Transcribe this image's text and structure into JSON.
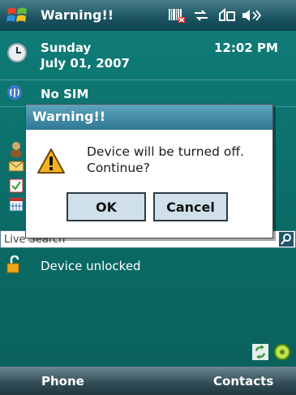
{
  "titlebar": {
    "title": "Warning!!",
    "icons": [
      "windows-start-icon",
      "barcode-icon",
      "sync-arrows-icon",
      "connectivity-icon",
      "volume-icon"
    ]
  },
  "today": {
    "date_day": "Sunday",
    "date_full": "July 01, 2007",
    "time": "12:02 PM",
    "phone_status": "No SIM",
    "search_placeholder": "Live Search",
    "lock_status": "Device unlocked"
  },
  "dialog": {
    "title": "Warning!!",
    "message_line1": "Device will be turned off.",
    "message_line2": "Continue?",
    "ok_label": "OK",
    "cancel_label": "Cancel"
  },
  "softkeys": {
    "left": "Phone",
    "right": "Contacts"
  },
  "colors": {
    "background": "#0b6f6a",
    "dialog_title": "#2f7895",
    "button_face": "#cfe0ea"
  }
}
